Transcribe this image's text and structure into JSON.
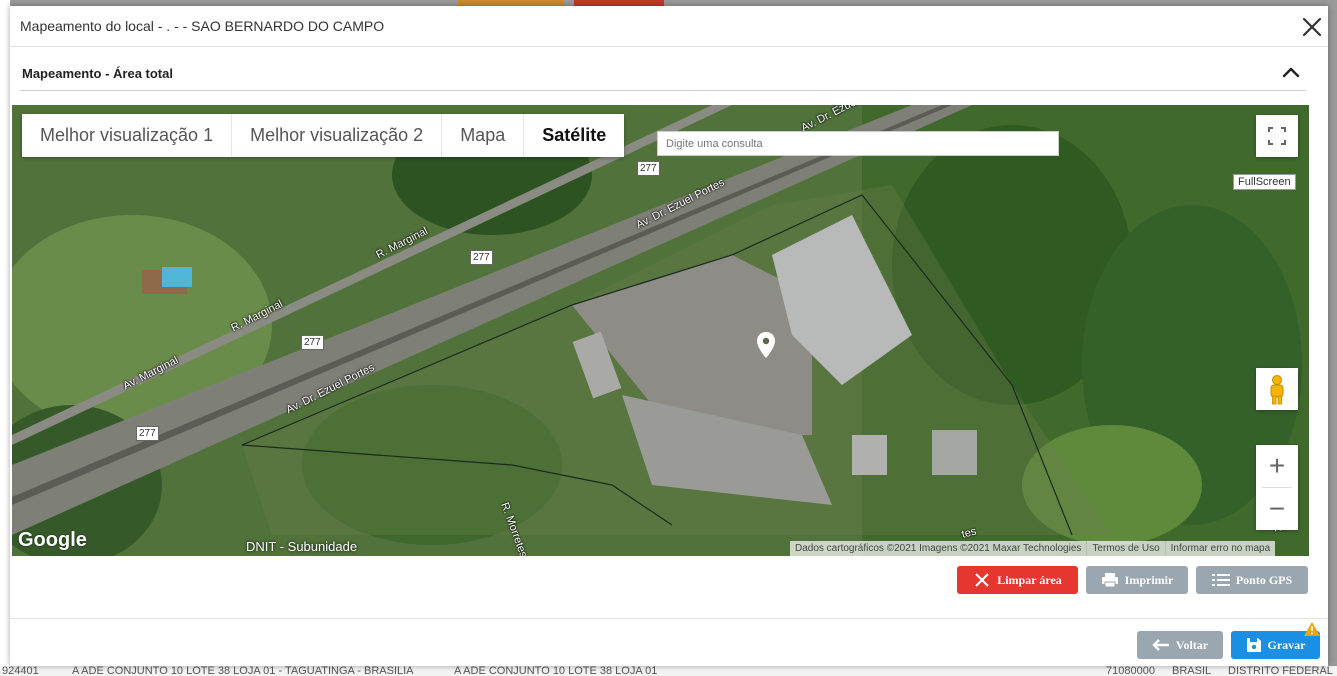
{
  "modal": {
    "title": "Mapeamento do local - . - - SAO BERNARDO DO CAMPO",
    "section_title": "Mapeamento - Área total"
  },
  "map": {
    "type_buttons": [
      {
        "label": "Melhor visualização 1",
        "active": false
      },
      {
        "label": "Melhor visualização 2",
        "active": false
      },
      {
        "label": "Mapa",
        "active": false
      },
      {
        "label": "Satélite",
        "active": true
      }
    ],
    "search_placeholder": "Digite uma consulta",
    "fullscreen_label": "FullScreen",
    "zoom_in": "+",
    "zoom_out": "−",
    "logo": "Google",
    "attribution": [
      "Dados cartográficos ©2021 Imagens ©2021 Maxar Technologies",
      "Termos de Uso",
      "Informar erro no mapa"
    ],
    "road_labels": [
      "Av. Marginal",
      "R. Marginal",
      "R. Marginal",
      "Av. Dr. Ezuel Portes",
      "Av. Dr. Ezuel Portes",
      "R. Morretes",
      "Av. Dr. Ezuel Portes",
      "tes",
      "ro D"
    ],
    "highway_shields": [
      "277",
      "277",
      "277",
      "277"
    ],
    "poi_label": "DNIT - Subunidade"
  },
  "actions": {
    "clear_area": "Limpar área",
    "print": "Imprimir",
    "gps_point": "Ponto GPS"
  },
  "footer": {
    "back": "Voltar",
    "save": "Gravar"
  },
  "background_row": [
    "924401",
    "A ADE CONJUNTO 10 LOTE 38 LOJA 01 - TAGUATINGA - BRASILIA",
    "A ADE CONJUNTO 10 LOTE 38 LOJA 01",
    "71080000",
    "BRASIL",
    "DISTRITO FEDERAL"
  ],
  "colors": {
    "danger": "#e5372f",
    "secondary": "#9aa6b0",
    "primary": "#1a8fe3",
    "warning": "#f0a30a"
  }
}
